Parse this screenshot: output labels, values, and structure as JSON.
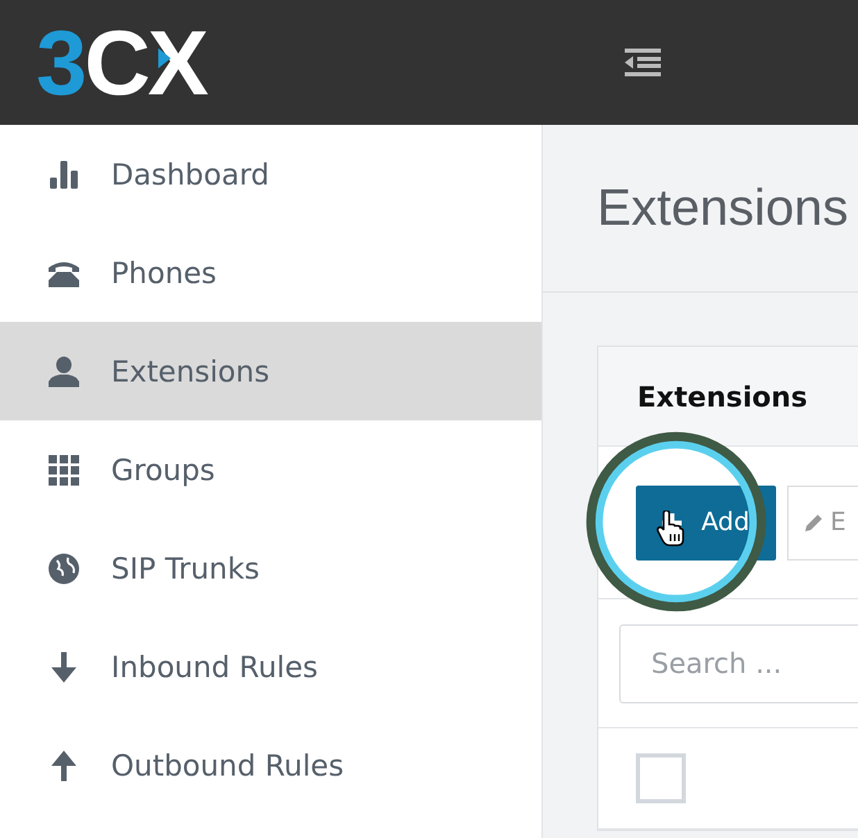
{
  "logo": {
    "digit": "3",
    "letters": "CX"
  },
  "sidebar": {
    "items": [
      {
        "kind": "chart",
        "label": "Dashboard",
        "selected": false
      },
      {
        "kind": "phone",
        "label": "Phones",
        "selected": false
      },
      {
        "kind": "user",
        "label": "Extensions",
        "selected": true
      },
      {
        "kind": "grid",
        "label": "Groups",
        "selected": false
      },
      {
        "kind": "globe",
        "label": "SIP Trunks",
        "selected": false
      },
      {
        "kind": "down",
        "label": "Inbound Rules",
        "selected": false
      },
      {
        "kind": "up",
        "label": "Outbound Rules",
        "selected": false
      }
    ]
  },
  "page_title": "Extensions",
  "panel": {
    "title": "Extensions",
    "add_button": "Add",
    "edit_button": "E",
    "search": {
      "placeholder": "Search ..."
    },
    "rows": [
      {
        "checked": false
      }
    ]
  }
}
